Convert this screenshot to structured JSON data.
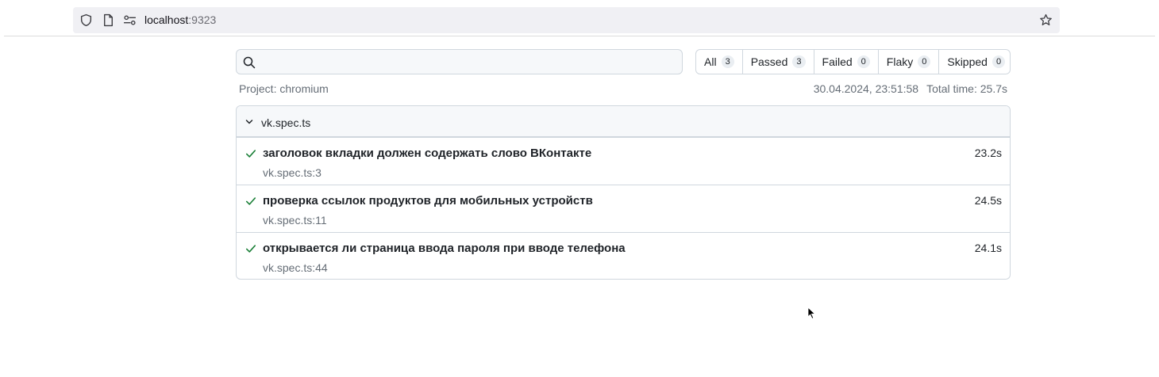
{
  "browser": {
    "url_host": "localhost",
    "url_port": ":9323"
  },
  "search": {
    "placeholder": "",
    "value": ""
  },
  "filters": [
    {
      "label": "All",
      "count": "3"
    },
    {
      "label": "Passed",
      "count": "3"
    },
    {
      "label": "Failed",
      "count": "0"
    },
    {
      "label": "Flaky",
      "count": "0"
    },
    {
      "label": "Skipped",
      "count": "0"
    }
  ],
  "report": {
    "project": "Project: chromium",
    "timestamp": "30.04.2024, 23:51:58",
    "total_time": "Total time: 25.7s"
  },
  "file": {
    "name": "vk.spec.ts",
    "tests": [
      {
        "title": "заголовок вкладки должен содержать слово ВКонтакте",
        "location": "vk.spec.ts:3",
        "duration": "23.2s",
        "status": "passed"
      },
      {
        "title": "проверка ссылок продуктов для мобильных устройств",
        "location": "vk.spec.ts:11",
        "duration": "24.5s",
        "status": "passed"
      },
      {
        "title": "открывается ли страница ввода пароля при вводе телефона",
        "location": "vk.spec.ts:44",
        "duration": "24.1s",
        "status": "passed"
      }
    ]
  },
  "colors": {
    "passed": "#1a7f37",
    "muted_text": "#656d76",
    "border": "#d0d7de"
  }
}
